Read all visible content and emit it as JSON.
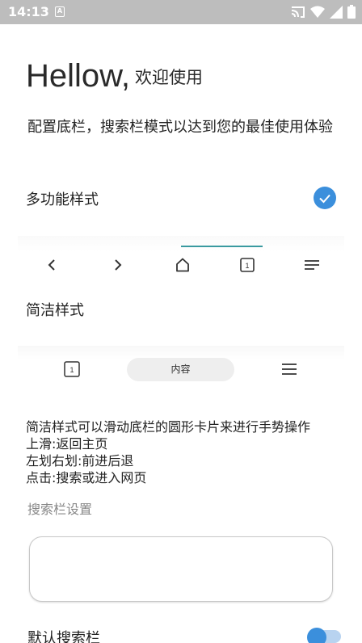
{
  "status_bar": {
    "time": "14:13",
    "notification_glyph": "A"
  },
  "greeting": {
    "title": "Hellow,",
    "subtitle": "欢迎使用"
  },
  "intro": "配置底栏，搜索栏模式以达到您的最佳使用体验",
  "multi_style": {
    "label": "多功能样式",
    "selected": true,
    "nav_icons": [
      "back-icon",
      "forward-icon",
      "home-icon",
      "tabs-icon",
      "menu-icon"
    ],
    "tab_count": "1"
  },
  "simple_style": {
    "label": "简洁样式",
    "tab_count": "1",
    "pill_text": "内容",
    "icons": [
      "tabs-icon",
      "menu-icon"
    ]
  },
  "gesture_info": {
    "line1": "简洁样式可以滑动底栏的圆形卡片来进行手势操作",
    "line2": "上滑:返回主页",
    "line3": "左划右划:前进后退",
    "line4": "点击:搜索或进入网页"
  },
  "search_settings": {
    "section_label": "搜索栏设置",
    "input_value": ""
  },
  "default_search": {
    "label": "默认搜索栏",
    "enabled": true
  },
  "colors": {
    "accent": "#3b8fdc",
    "indicator": "#3a9aa0",
    "status_bar": "#bdbdbd"
  }
}
